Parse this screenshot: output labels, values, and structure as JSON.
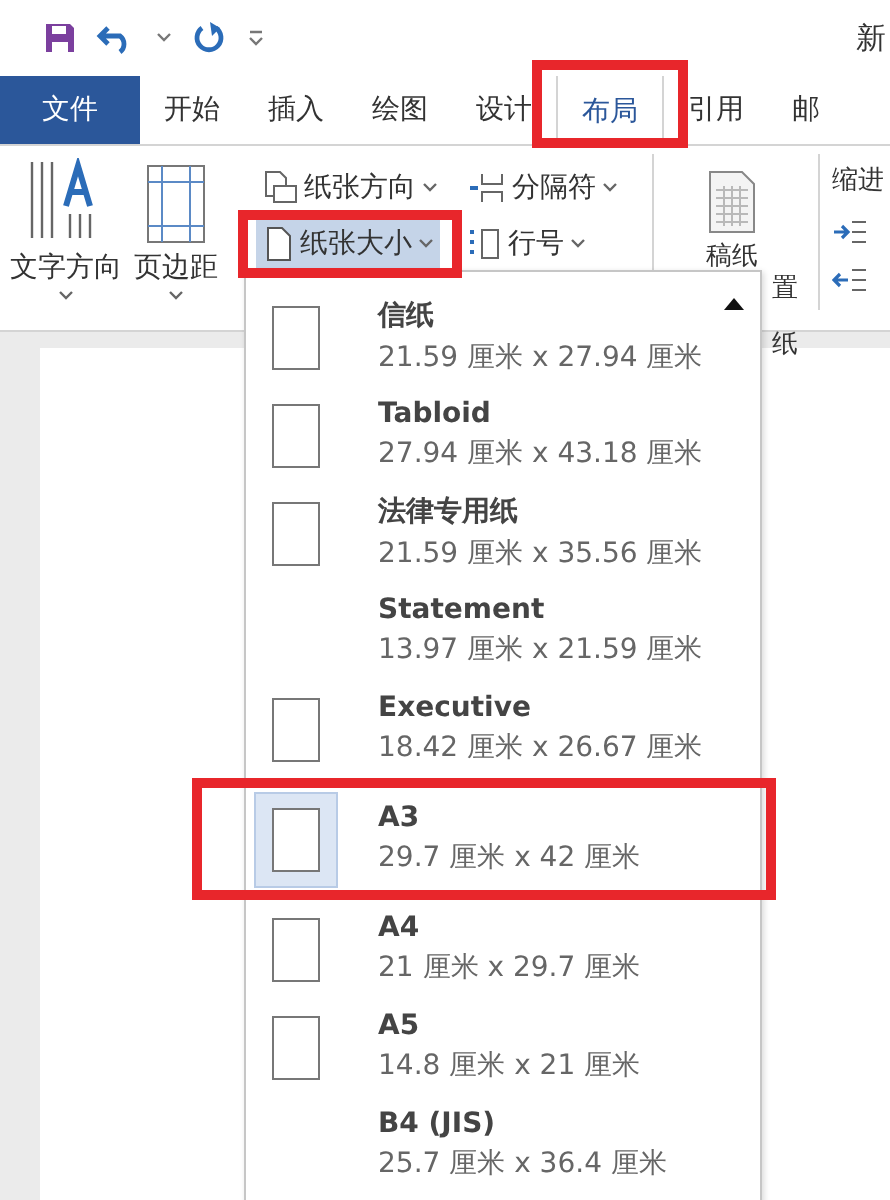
{
  "title_bar": {
    "title": "新"
  },
  "tabs": [
    {
      "label": "文件",
      "kind": "file",
      "selected": false,
      "highlighted": false
    },
    {
      "label": "开始",
      "kind": "tab",
      "selected": false,
      "highlighted": false
    },
    {
      "label": "插入",
      "kind": "tab",
      "selected": false,
      "highlighted": false
    },
    {
      "label": "绘图",
      "kind": "tab",
      "selected": false,
      "highlighted": false
    },
    {
      "label": "设计",
      "kind": "tab",
      "selected": false,
      "highlighted": false
    },
    {
      "label": "布局",
      "kind": "tab",
      "selected": true,
      "highlighted": true
    },
    {
      "label": "引用",
      "kind": "tab",
      "selected": false,
      "highlighted": false
    },
    {
      "label": "邮",
      "kind": "tab",
      "selected": false,
      "highlighted": false
    }
  ],
  "ribbon": {
    "text_direction": {
      "label": "文字方向"
    },
    "margins": {
      "label": "页边距"
    },
    "small_buttons": [
      {
        "label": "纸张方向",
        "kind": "orientation",
        "selected": false,
        "highlighted": false
      },
      {
        "label": "纸张大小",
        "kind": "size",
        "selected": true,
        "highlighted": true
      },
      {
        "label": "分隔符",
        "kind": "breaks",
        "selected": false,
        "highlighted": false
      },
      {
        "label": "行号",
        "kind": "line_numbers",
        "selected": false,
        "highlighted": false
      }
    ],
    "manuscript": {
      "label": "稿纸",
      "fragments": [
        "置",
        "纸"
      ]
    },
    "indent": {
      "label": "缩进"
    }
  },
  "paper_menu": {
    "items": [
      {
        "name": "信纸",
        "size": "21.59 厘米 x 27.94 厘米",
        "icon": true,
        "selected": false,
        "highlighted": false
      },
      {
        "name": "Tabloid",
        "size": "27.94 厘米 x 43.18 厘米",
        "icon": true,
        "selected": false,
        "highlighted": false
      },
      {
        "name": "法律专用纸",
        "size": "21.59 厘米 x 35.56 厘米",
        "icon": true,
        "selected": false,
        "highlighted": false
      },
      {
        "name": "Statement",
        "size": "13.97 厘米 x 21.59 厘米",
        "icon": false,
        "selected": false,
        "highlighted": false
      },
      {
        "name": "Executive",
        "size": "18.42 厘米 x 26.67 厘米",
        "icon": true,
        "selected": false,
        "highlighted": false
      },
      {
        "name": "A3",
        "size": "29.7 厘米 x 42 厘米",
        "icon": true,
        "selected": true,
        "highlighted": true
      },
      {
        "name": "A4",
        "size": "21 厘米 x 29.7 厘米",
        "icon": true,
        "selected": false,
        "highlighted": false
      },
      {
        "name": "A5",
        "size": "14.8 厘米 x 21 厘米",
        "icon": true,
        "selected": false,
        "highlighted": false
      },
      {
        "name": "B4 (JIS)",
        "size": "25.7 厘米 x 36.4 厘米",
        "icon": false,
        "selected": false,
        "highlighted": false
      }
    ]
  }
}
